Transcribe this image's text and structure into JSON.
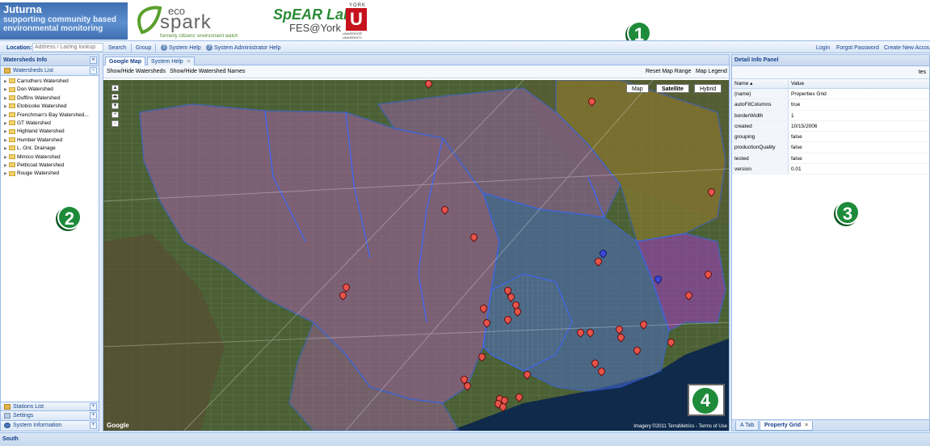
{
  "header": {
    "brand_title": "Juturna",
    "brand_sub_1": "supporting community based",
    "brand_sub_2": "environmental monitoring",
    "eco_top": "eco",
    "eco_main": "spark",
    "eco_tagline": "formerly citizens' environment watch",
    "spear_title": "SpEAR Lab",
    "spear_sub": "FES@York",
    "york_word": "YORK",
    "york_mark": "U",
    "york_uni": "UNIVERSITÉ UNIVERSITY"
  },
  "toolbar": {
    "location_label": "Location:",
    "location_placeholder": "Address / Lat/lng lookup",
    "search": "Search",
    "group": "Group",
    "system_help": "System Help",
    "sysadmin_help": "System Administrator Help",
    "login": "Login",
    "forgot_password": "Forgot Password",
    "create_account": "Create New Account"
  },
  "left": {
    "title": "Watersheds Info",
    "list_title": "Watersheds List",
    "watersheds": [
      "Carruthers Watershed",
      "Don Watershed",
      "Duffins Watershed",
      "Etobicoke Watershed",
      "Frenchman's Bay Watershed...",
      "GT Watershed",
      "Highland Watershed",
      "Humber Watershed",
      "L. Ont. Drainage",
      "Mimico Watershed",
      "Petticoat Watershed",
      "Rouge Watershed"
    ],
    "stations_list": "Stations List",
    "settings": "Settings",
    "system_information": "System Information"
  },
  "center": {
    "tab_google_map": "Google Map",
    "tab_system_help": "System Help",
    "show_hide_watersheds": "Show/Hide Watersheds",
    "show_hide_names": "Show/Hide Watershed Names",
    "reset_map_range": "Reset Map Range",
    "map_legend": "Map Legend",
    "map_types": [
      "Map",
      "Satellite",
      "Hybrid"
    ],
    "credit": "Imagery ©2011 TerraMetrics - Terms of Use",
    "google": "Google"
  },
  "right": {
    "title": "Detail Info Panel",
    "sub_label": "tes",
    "col_name": "Name ▴",
    "col_value": "Value",
    "properties": [
      {
        "name": "(name)",
        "value": "Properties Grid"
      },
      {
        "name": "autoFitColumns",
        "value": "true"
      },
      {
        "name": "borderWidth",
        "value": "1"
      },
      {
        "name": "created",
        "value": "10/15/2006"
      },
      {
        "name": "grouping",
        "value": "false"
      },
      {
        "name": "productionQuality",
        "value": "false"
      },
      {
        "name": "tested",
        "value": "false"
      },
      {
        "name": "version",
        "value": "0.01"
      }
    ],
    "tab_a": "A Tab",
    "tab_property_grid": "Property Grid"
  },
  "badges": [
    "1",
    "2",
    "3",
    "4"
  ],
  "footer": "South"
}
